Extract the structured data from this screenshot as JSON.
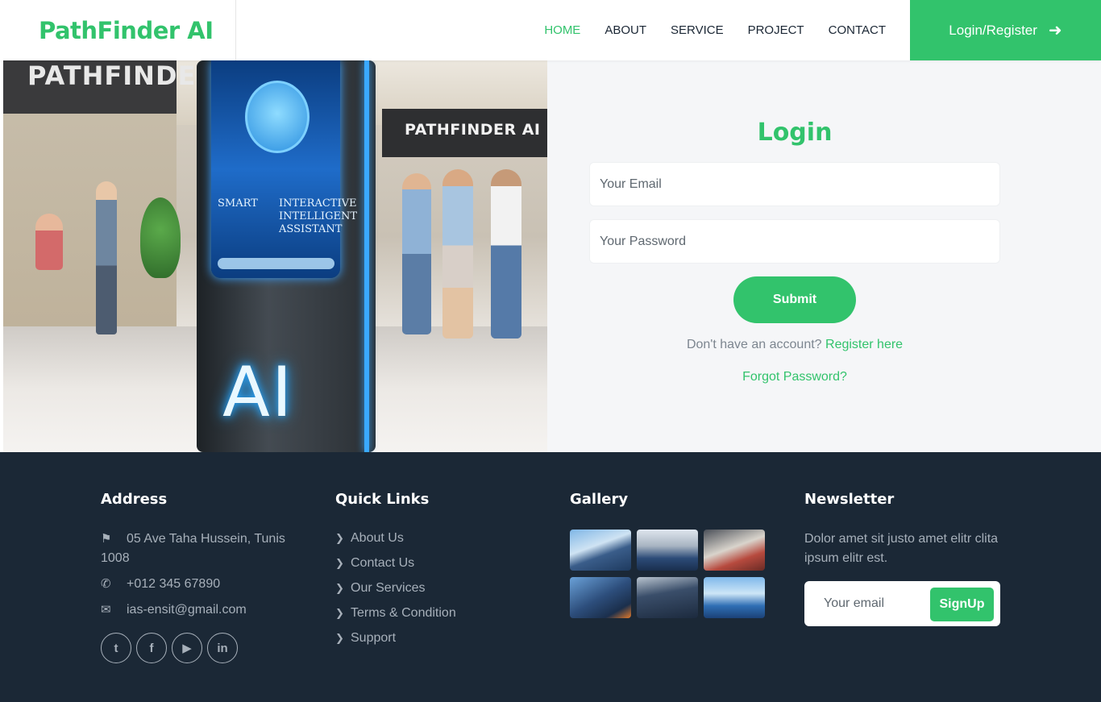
{
  "brand": {
    "name": "PathFinder AI"
  },
  "nav": {
    "items": [
      {
        "label": "HOME",
        "active": true
      },
      {
        "label": "ABOUT",
        "active": false
      },
      {
        "label": "SERVICE",
        "active": false
      },
      {
        "label": "PROJECT",
        "active": false
      },
      {
        "label": "CONTACT",
        "active": false
      }
    ],
    "cta_label": "Login/Register",
    "cta_icon": "arrow-right-icon"
  },
  "hero": {
    "sign_left": "PATHFINDER AI",
    "sign_right": "PATHFINDER AI",
    "screen_text_left": "SMART",
    "screen_text_right": "INTERACTIVE INTELLIGENT ASSISTANT",
    "kiosk_text": "AI"
  },
  "login": {
    "title": "Login",
    "email_placeholder": "Your Email",
    "password_placeholder": "Your Password",
    "submit_label": "Submit",
    "register_prompt": "Don't have an account?",
    "register_link": "Register here",
    "forgot_link": "Forgot Password?"
  },
  "footer": {
    "address": {
      "title": "Address",
      "street": "05 Ave Taha Hussein, Tunis 1008",
      "phone": "+012 345 67890",
      "email": "ias-ensit@gmail.com",
      "socials": [
        "twitter-icon",
        "facebook-icon",
        "youtube-icon",
        "linkedin-icon"
      ]
    },
    "quick_links": {
      "title": "Quick Links",
      "items": [
        "About Us",
        "Contact Us",
        "Our Services",
        "Terms & Condition",
        "Support"
      ]
    },
    "gallery": {
      "title": "Gallery"
    },
    "newsletter": {
      "title": "Newsletter",
      "text": "Dolor amet sit justo amet elitr clita ipsum elitr est.",
      "email_placeholder": "Your email",
      "button_label": "SignUp"
    }
  },
  "colors": {
    "accent": "#32c36c",
    "footer_bg": "#1b2836",
    "login_bg": "#f5f6f8"
  }
}
